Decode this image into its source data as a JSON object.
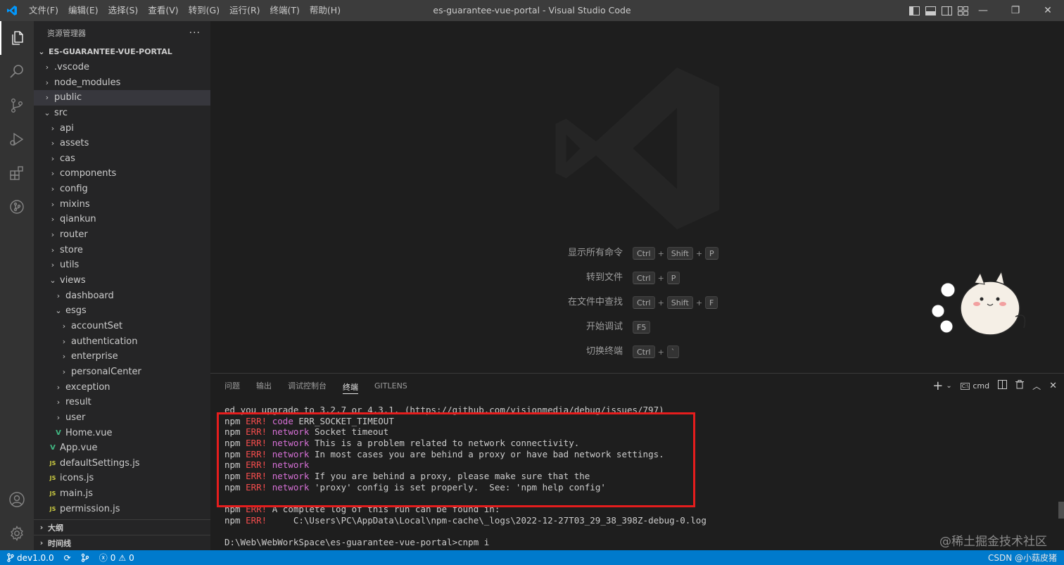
{
  "titlebar": {
    "menu": [
      "文件(F)",
      "编辑(E)",
      "选择(S)",
      "查看(V)",
      "转到(G)",
      "运行(R)",
      "终端(T)",
      "帮助(H)"
    ],
    "title": "es-guarantee-vue-portal - Visual Studio Code",
    "window_controls": [
      "—",
      "❐",
      "✕"
    ]
  },
  "activity_bar": [
    "explorer-icon",
    "search-icon",
    "source-control-icon",
    "run-debug-icon",
    "extensions-icon",
    "gitlens-icon",
    "account-icon",
    "settings-gear-icon"
  ],
  "sidebar": {
    "title": "资源管理器",
    "more": "···",
    "root": "ES-GUARANTEE-VUE-PORTAL",
    "tree": [
      {
        "label": ".vscode",
        "type": "folder",
        "depth": 1,
        "open": false
      },
      {
        "label": "node_modules",
        "type": "folder",
        "depth": 1,
        "open": false
      },
      {
        "label": "public",
        "type": "folder",
        "depth": 1,
        "open": false,
        "selected": true
      },
      {
        "label": "src",
        "type": "folder",
        "depth": 1,
        "open": true
      },
      {
        "label": "api",
        "type": "folder",
        "depth": 2,
        "open": false
      },
      {
        "label": "assets",
        "type": "folder",
        "depth": 2,
        "open": false
      },
      {
        "label": "cas",
        "type": "folder",
        "depth": 2,
        "open": false
      },
      {
        "label": "components",
        "type": "folder",
        "depth": 2,
        "open": false
      },
      {
        "label": "config",
        "type": "folder",
        "depth": 2,
        "open": false
      },
      {
        "label": "mixins",
        "type": "folder",
        "depth": 2,
        "open": false
      },
      {
        "label": "qiankun",
        "type": "folder",
        "depth": 2,
        "open": false
      },
      {
        "label": "router",
        "type": "folder",
        "depth": 2,
        "open": false
      },
      {
        "label": "store",
        "type": "folder",
        "depth": 2,
        "open": false
      },
      {
        "label": "utils",
        "type": "folder",
        "depth": 2,
        "open": false
      },
      {
        "label": "views",
        "type": "folder",
        "depth": 2,
        "open": true
      },
      {
        "label": "dashboard",
        "type": "folder",
        "depth": 3,
        "open": false
      },
      {
        "label": "esgs",
        "type": "folder",
        "depth": 3,
        "open": true
      },
      {
        "label": "accountSet",
        "type": "folder",
        "depth": 4,
        "open": false
      },
      {
        "label": "authentication",
        "type": "folder",
        "depth": 4,
        "open": false
      },
      {
        "label": "enterprise",
        "type": "folder",
        "depth": 4,
        "open": false
      },
      {
        "label": "personalCenter",
        "type": "folder",
        "depth": 4,
        "open": false
      },
      {
        "label": "exception",
        "type": "folder",
        "depth": 3,
        "open": false
      },
      {
        "label": "result",
        "type": "folder",
        "depth": 3,
        "open": false
      },
      {
        "label": "user",
        "type": "folder",
        "depth": 3,
        "open": false
      },
      {
        "label": "Home.vue",
        "type": "vue",
        "depth": 3
      },
      {
        "label": "App.vue",
        "type": "vue",
        "depth": 2
      },
      {
        "label": "defaultSettings.js",
        "type": "js",
        "depth": 2
      },
      {
        "label": "icons.js",
        "type": "js",
        "depth": 2
      },
      {
        "label": "main.js",
        "type": "js",
        "depth": 2
      },
      {
        "label": "permission.js",
        "type": "js",
        "depth": 2
      }
    ],
    "sections": [
      "大纲",
      "时间线"
    ],
    "icons": {
      "vue": "V",
      "js": "JS"
    }
  },
  "editor": {
    "shortcuts": [
      {
        "label": "显示所有命令",
        "keys": [
          "Ctrl",
          "Shift",
          "P"
        ]
      },
      {
        "label": "转到文件",
        "keys": [
          "Ctrl",
          "P"
        ]
      },
      {
        "label": "在文件中查找",
        "keys": [
          "Ctrl",
          "Shift",
          "F"
        ]
      },
      {
        "label": "开始调试",
        "keys": [
          "F5"
        ]
      },
      {
        "label": "切换终端",
        "keys": [
          "Ctrl",
          "`"
        ]
      }
    ]
  },
  "panel": {
    "tabs": [
      "问题",
      "输出",
      "调试控制台",
      "终端",
      "GITLENS"
    ],
    "active_tab": "终端",
    "shell": "cmd",
    "terminal_lines": [
      [
        {
          "t": "ed you upgrade to 3.2.7 or 4.3.1. (https://github.com/visionmedia/debug/issues/797)",
          "c": "n"
        }
      ],
      [
        {
          "t": "npm ",
          "c": "n"
        },
        {
          "t": "ERR!",
          "c": "err"
        },
        {
          "t": " code",
          "c": "mag"
        },
        {
          "t": " ERR_SOCKET_TIMEOUT",
          "c": "n"
        }
      ],
      [
        {
          "t": "npm ",
          "c": "n"
        },
        {
          "t": "ERR!",
          "c": "err"
        },
        {
          "t": " network",
          "c": "mag"
        },
        {
          "t": " Socket timeout",
          "c": "n"
        }
      ],
      [
        {
          "t": "npm ",
          "c": "n"
        },
        {
          "t": "ERR!",
          "c": "err"
        },
        {
          "t": " network",
          "c": "mag"
        },
        {
          "t": " This is a problem related to network connectivity.",
          "c": "n"
        }
      ],
      [
        {
          "t": "npm ",
          "c": "n"
        },
        {
          "t": "ERR!",
          "c": "err"
        },
        {
          "t": " network",
          "c": "mag"
        },
        {
          "t": " In most cases you are behind a proxy or have bad network settings.",
          "c": "n"
        }
      ],
      [
        {
          "t": "npm ",
          "c": "n"
        },
        {
          "t": "ERR!",
          "c": "err"
        },
        {
          "t": " network",
          "c": "mag"
        }
      ],
      [
        {
          "t": "npm ",
          "c": "n"
        },
        {
          "t": "ERR!",
          "c": "err"
        },
        {
          "t": " network",
          "c": "mag"
        },
        {
          "t": " If you are behind a proxy, please make sure that the",
          "c": "n"
        }
      ],
      [
        {
          "t": "npm ",
          "c": "n"
        },
        {
          "t": "ERR!",
          "c": "err"
        },
        {
          "t": " network",
          "c": "mag"
        },
        {
          "t": " 'proxy' config is set properly.  See: 'npm help config'",
          "c": "n"
        }
      ],
      [
        {
          "t": "",
          "c": "n"
        }
      ],
      [
        {
          "t": "npm ",
          "c": "n"
        },
        {
          "t": "ERR!",
          "c": "err"
        },
        {
          "t": " A complete log of this run can be found in:",
          "c": "n"
        }
      ],
      [
        {
          "t": "npm ",
          "c": "n"
        },
        {
          "t": "ERR!",
          "c": "err"
        },
        {
          "t": "     C:\\Users\\PC\\AppData\\Local\\npm-cache\\_logs\\2022-12-27T03_29_38_398Z-debug-0.log",
          "c": "n"
        }
      ],
      [
        {
          "t": "",
          "c": "n"
        }
      ],
      [
        {
          "t": "D:\\Web\\WebWorkSpace\\es-guarantee-vue-portal>cnpm i",
          "c": "n"
        }
      ]
    ],
    "watermark_text": "@稀土掘金技术社区"
  },
  "statusbar": {
    "branch": "dev1.0.0",
    "errors": "0",
    "warnings": "0",
    "csdn": "CSDN @小菇皮猪"
  },
  "colors": {
    "accent": "#007acc",
    "err": "#f14c4c",
    "magenta": "#d670d6",
    "highlight_box": "#e51d1d"
  }
}
